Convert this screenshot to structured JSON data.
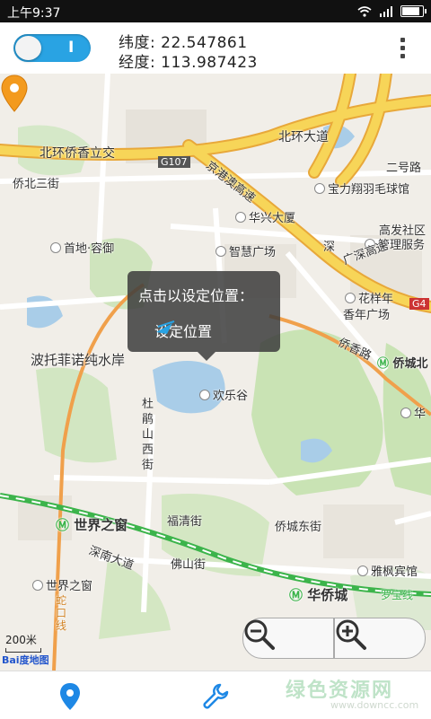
{
  "status_bar": {
    "time": "上午9:37",
    "battery_percent": 80
  },
  "header": {
    "toggle_mark": "I",
    "latitude_label": "纬度: 22.547861",
    "longitude_label": "经度: 113.987423"
  },
  "map": {
    "labels": [
      "北环侨香立交",
      "北环大道",
      "G107",
      "京港澳高速",
      "二号路",
      "宝力翔羽毛球馆",
      "侨北三街",
      "华兴大厦",
      "高发社区",
      "管理服务",
      "首地·容御",
      "智慧广场",
      "深",
      "广深高速",
      "花样年",
      "香年广场",
      "G4",
      "波托菲诺纯水岸",
      "侨香路",
      "侨城北",
      "华",
      "杜鹃山西街",
      "欢乐谷",
      "世界之窗",
      "福清街",
      "侨城东街",
      "深南大道",
      "佛山街",
      "雅枫宾馆",
      "世界之窗",
      "华侨城",
      "罗宝线",
      "蛇口线"
    ],
    "scale_text": "200米",
    "brand_text": "Bai度地图"
  },
  "popup": {
    "prompt": "点击以设定位置：",
    "action_label": "设定位置"
  },
  "zoom": {
    "out_icon": "zoom-out-icon",
    "in_icon": "zoom-in-icon"
  },
  "bottom_nav": {
    "tabs": [
      "location-icon",
      "wrench-icon"
    ]
  },
  "watermark": {
    "text": "绿色资源网",
    "sub": "www.downcc.com"
  },
  "colors": {
    "accent": "#29a3e3",
    "nav_active": "#1e88e5",
    "highway": "#f5c842",
    "metro": "#3cb44b"
  }
}
